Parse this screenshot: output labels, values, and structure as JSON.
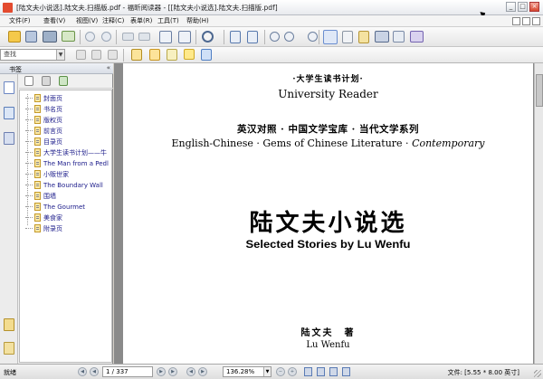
{
  "window": {
    "title": "[陆文夫小说选].陆文夫.扫描版.pdf - 福昕阅读器 - [[陆文夫小说选].陆文夫.扫描版.pdf]",
    "min": "_",
    "max": "□",
    "close": "×"
  },
  "menu": [
    {
      "label": "文件(F)"
    },
    {
      "label": "查看(V)"
    },
    {
      "label": "视图(V)"
    },
    {
      "label": "注释(C)"
    },
    {
      "label": "表单(R)"
    },
    {
      "label": "工具(T)"
    },
    {
      "label": "帮助(H)"
    }
  ],
  "toolbar2": {
    "zoom_combo": "查找"
  },
  "sidebar": {
    "header": "书签",
    "collapse": "«",
    "bookmarks": [
      "封面页",
      "书名页",
      "版权页",
      "前言页",
      "目录页",
      "大学生读书计划——牛",
      "The Man from a Pedl",
      "小贩世家",
      "The Boundary Wall",
      "围墙",
      "The Gourmet",
      "美食家",
      "附录页"
    ]
  },
  "page": {
    "series_cn": "·大学生读书计划·",
    "series_en": "University Reader",
    "collection_cn": "英汉对照 · 中国文学宝库 · 当代文学系列",
    "collection_en_main": "English-Chinese · Gems of Chinese Literature · ",
    "collection_en_italic": "Contemporary",
    "title_cn": "陆文夫小说选",
    "title_en": "Selected Stories by Lu Wenfu",
    "author_cn": "陆文夫　著",
    "author_en": "Lu Wenfu"
  },
  "status": {
    "ready": "就绪",
    "page_indicator": "1 / 337",
    "zoom": "136.28%",
    "page_size": "文件: [5.55 * 8.00 英寸]"
  },
  "colors": {
    "page_bg": "#ffffff",
    "canvas_bg": "#8a8a8a",
    "bookmark_text": "#1b1b8a"
  }
}
